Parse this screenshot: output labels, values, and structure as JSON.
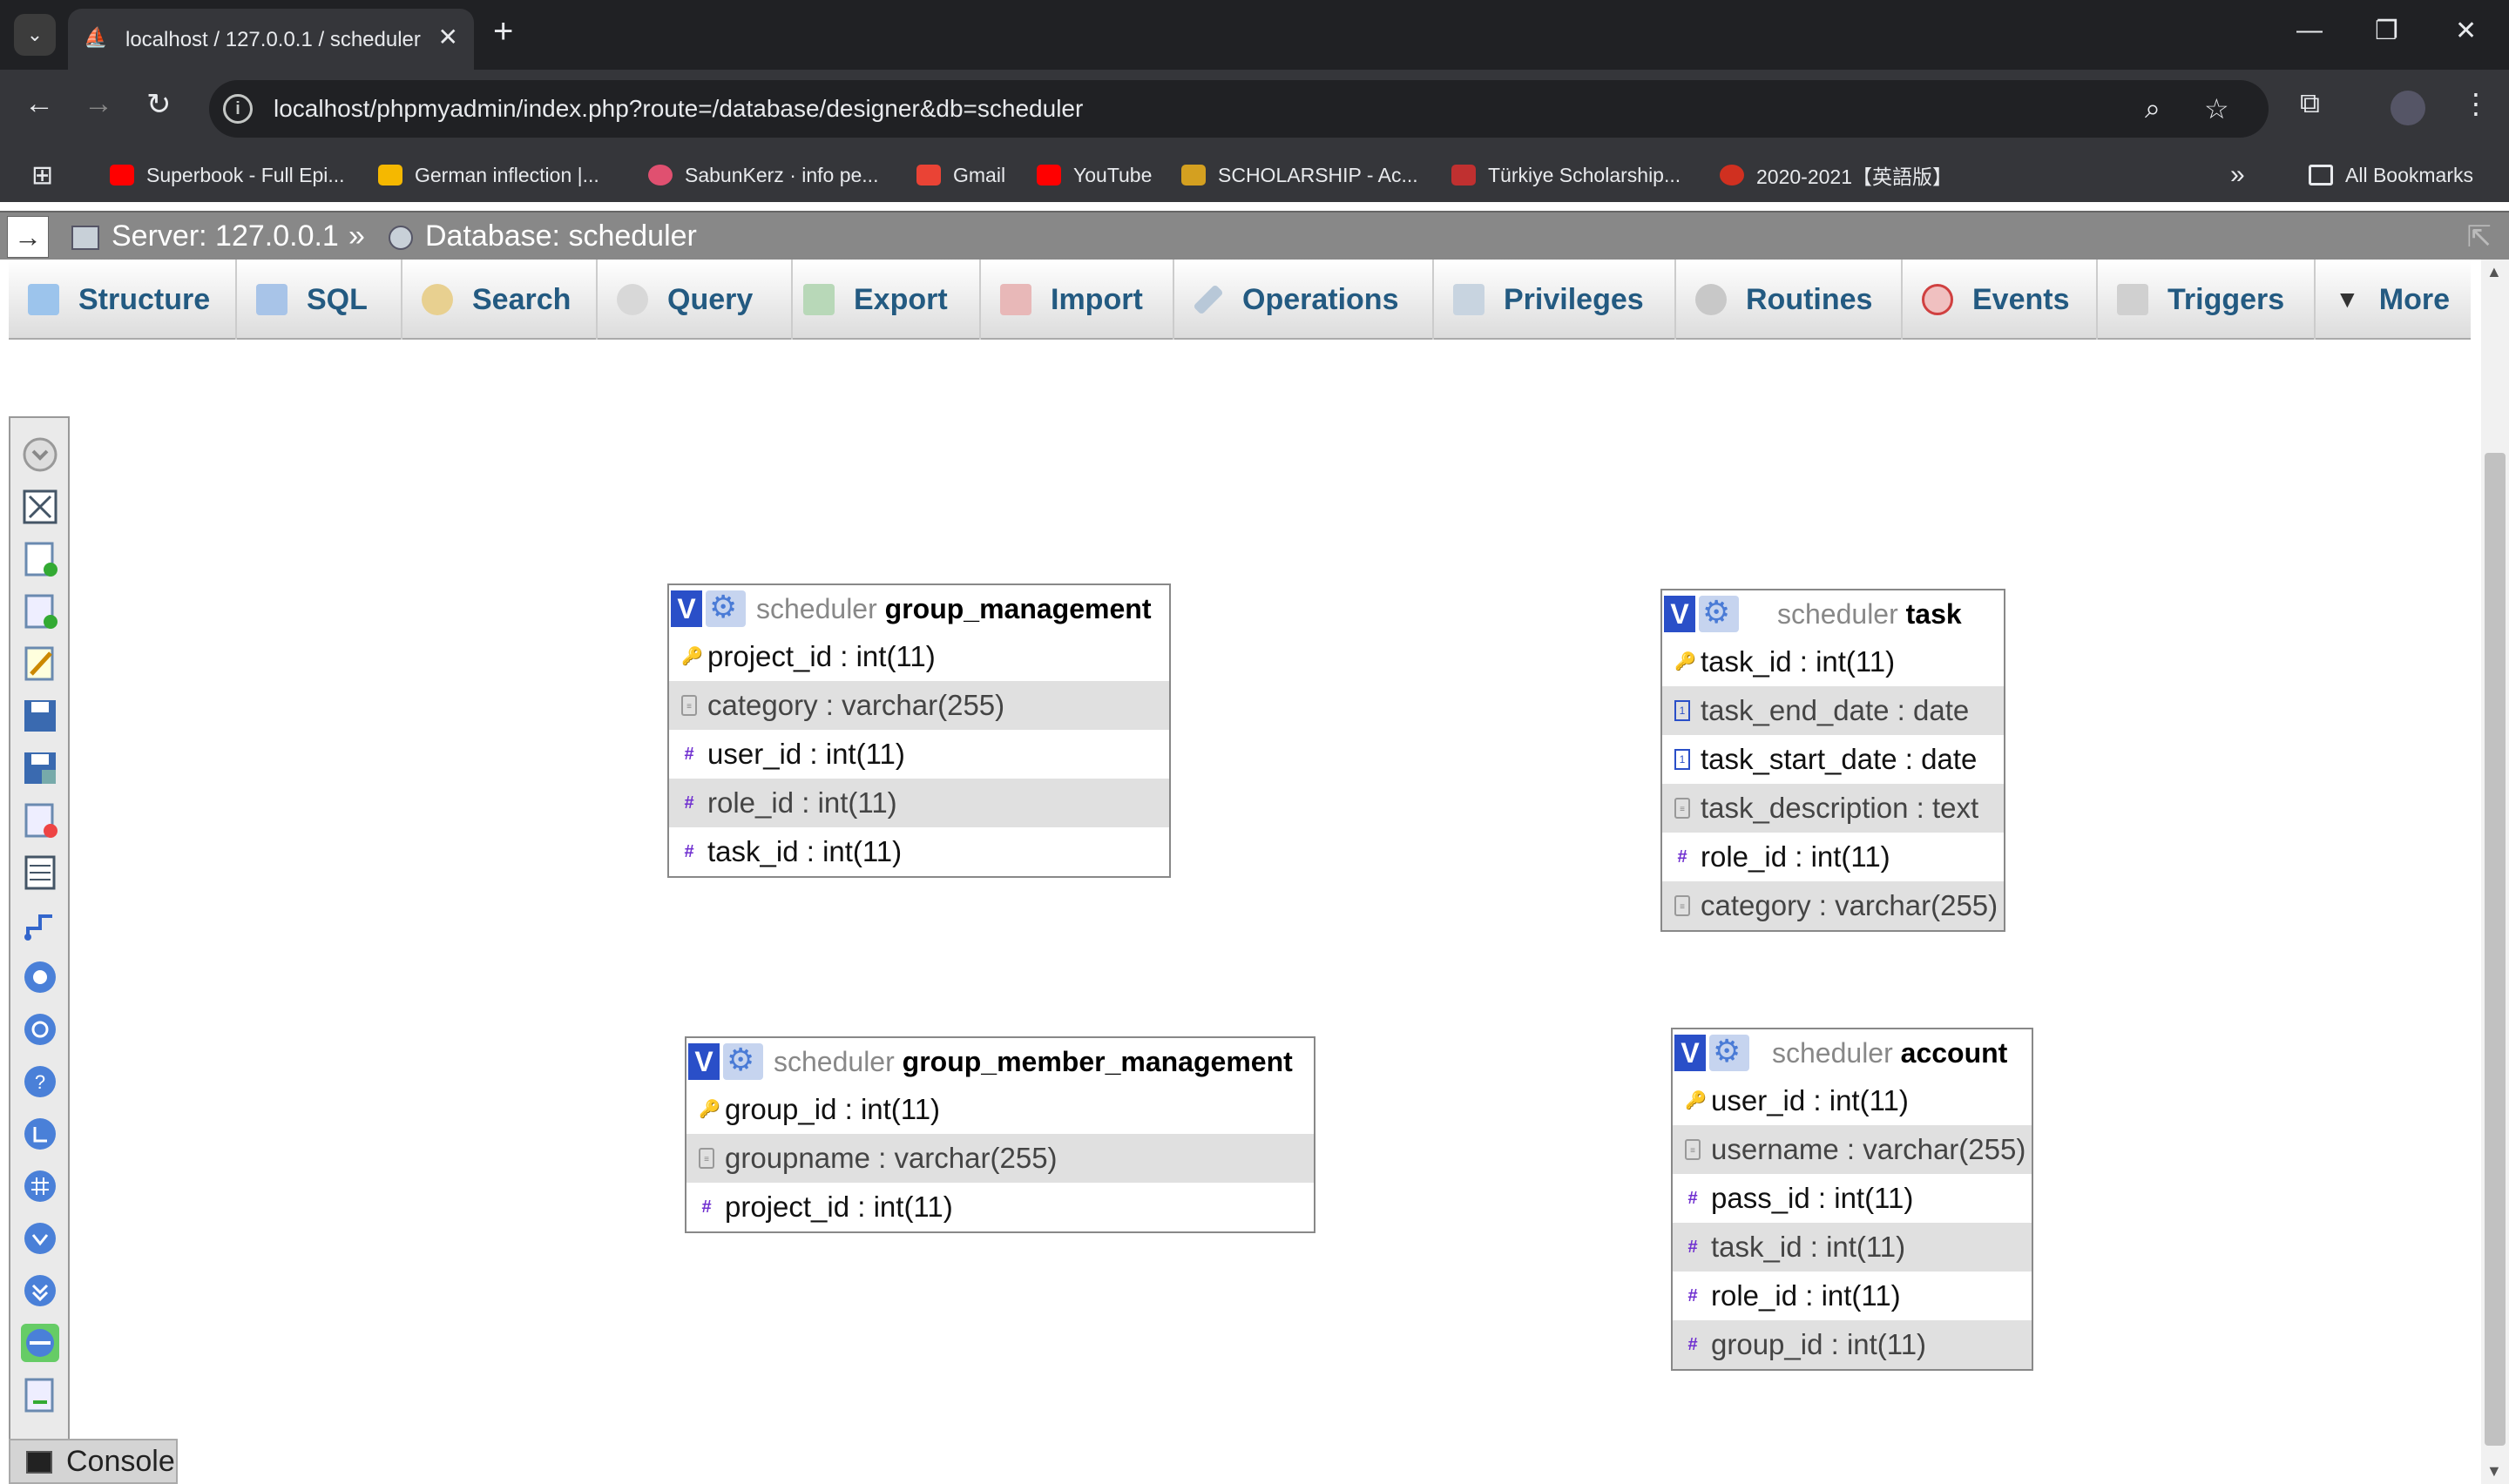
{
  "browser": {
    "tab_title": "localhost / 127.0.0.1 / scheduler",
    "url": "localhost/phpmyadmin/index.php?route=/database/designer&db=scheduler",
    "bookmarks": [
      {
        "label": "Superbook - Full Epi...",
        "color": "#ff0000"
      },
      {
        "label": "German inflection |...",
        "color": "#f5b800"
      },
      {
        "label": "SabunKerz · info pe...",
        "color": "#e05070"
      },
      {
        "label": "Gmail",
        "color": "#ea4335"
      },
      {
        "label": "YouTube",
        "color": "#ff0000"
      },
      {
        "label": "SCHOLARSHIP - Ac...",
        "color": "#d4a020"
      },
      {
        "label": "Türkiye Scholarship...",
        "color": "#c03030"
      },
      {
        "label": "2020-2021【英語版】",
        "color": "#d03020"
      }
    ],
    "all_bookmarks": "All Bookmarks"
  },
  "pma": {
    "server": "Server: 127.0.0.1",
    "separator": "»",
    "database": "Database: scheduler",
    "menu": [
      {
        "label": "Structure",
        "icon": "structure-icon",
        "color": "#4a90d9"
      },
      {
        "label": "SQL",
        "icon": "sql-icon",
        "color": "#5a8fd0"
      },
      {
        "label": "Search",
        "icon": "search-icon",
        "color": "#d0a040"
      },
      {
        "label": "Query",
        "icon": "query-icon",
        "color": "#b0b0b0"
      },
      {
        "label": "Export",
        "icon": "export-icon",
        "color": "#5a9a5a"
      },
      {
        "label": "Import",
        "icon": "import-icon",
        "color": "#c05050"
      },
      {
        "label": "Operations",
        "icon": "wrench-icon",
        "color": "#6080a0"
      },
      {
        "label": "Privileges",
        "icon": "privileges-icon",
        "color": "#7090b0"
      },
      {
        "label": "Routines",
        "icon": "routines-icon",
        "color": "#808080"
      },
      {
        "label": "Events",
        "icon": "clock-icon",
        "color": "#d04040"
      },
      {
        "label": "Triggers",
        "icon": "triggers-icon",
        "color": "#909090"
      },
      {
        "label": "More",
        "icon": "chevron-down-icon",
        "color": "#333333"
      }
    ],
    "console": "Console"
  },
  "designer": {
    "tables": [
      {
        "db": "scheduler",
        "name": "group_management",
        "columns": [
          {
            "text": "project_id : int(11)",
            "type": "key"
          },
          {
            "text": "category : varchar(255)",
            "type": "txt"
          },
          {
            "text": "user_id : int(11)",
            "type": "num"
          },
          {
            "text": "role_id : int(11)",
            "type": "num"
          },
          {
            "text": "task_id : int(11)",
            "type": "num"
          }
        ]
      },
      {
        "db": "scheduler",
        "name": "task",
        "columns": [
          {
            "text": "task_id : int(11)",
            "type": "key"
          },
          {
            "text": "task_end_date : date",
            "type": "date"
          },
          {
            "text": "task_start_date : date",
            "type": "date"
          },
          {
            "text": "task_description : text",
            "type": "txt"
          },
          {
            "text": "role_id : int(11)",
            "type": "num"
          },
          {
            "text": "category : varchar(255)",
            "type": "txt"
          }
        ]
      },
      {
        "db": "scheduler",
        "name": "group_member_management",
        "columns": [
          {
            "text": "group_id : int(11)",
            "type": "key"
          },
          {
            "text": "groupname : varchar(255)",
            "type": "txt"
          },
          {
            "text": "project_id : int(11)",
            "type": "num"
          }
        ]
      },
      {
        "db": "scheduler",
        "name": "account",
        "columns": [
          {
            "text": "user_id : int(11)",
            "type": "key"
          },
          {
            "text": "username : varchar(255)",
            "type": "txt"
          },
          {
            "text": "pass_id : int(11)",
            "type": "num"
          },
          {
            "text": "task_id : int(11)",
            "type": "num"
          },
          {
            "text": "role_id : int(11)",
            "type": "num"
          },
          {
            "text": "group_id : int(11)",
            "type": "num"
          }
        ]
      }
    ]
  }
}
